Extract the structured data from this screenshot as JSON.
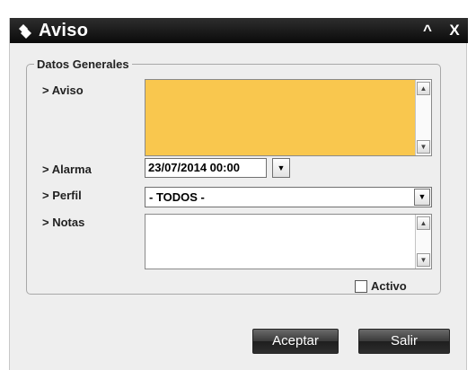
{
  "window": {
    "title": "Aviso",
    "minimize_glyph": "^",
    "close_glyph": "X",
    "title_icon": "diamond-logo-icon"
  },
  "group": {
    "legend": "Datos Generales"
  },
  "fields": {
    "aviso_label": "> Aviso",
    "aviso_value": "",
    "aviso_bg_color": "#f9c74e",
    "alarma_label": "> Alarma",
    "alarma_value": "23/07/2014 00:00",
    "perfil_label": "> Perfil",
    "perfil_value": "- TODOS -",
    "notas_label": "> Notas",
    "notas_value": ""
  },
  "activo": {
    "label": "Activo",
    "checked": false
  },
  "buttons": {
    "accept": "Aceptar",
    "exit": "Salir"
  },
  "icons": {
    "scroll_up": "▲",
    "scroll_down": "▼",
    "dropdown": "▼"
  }
}
